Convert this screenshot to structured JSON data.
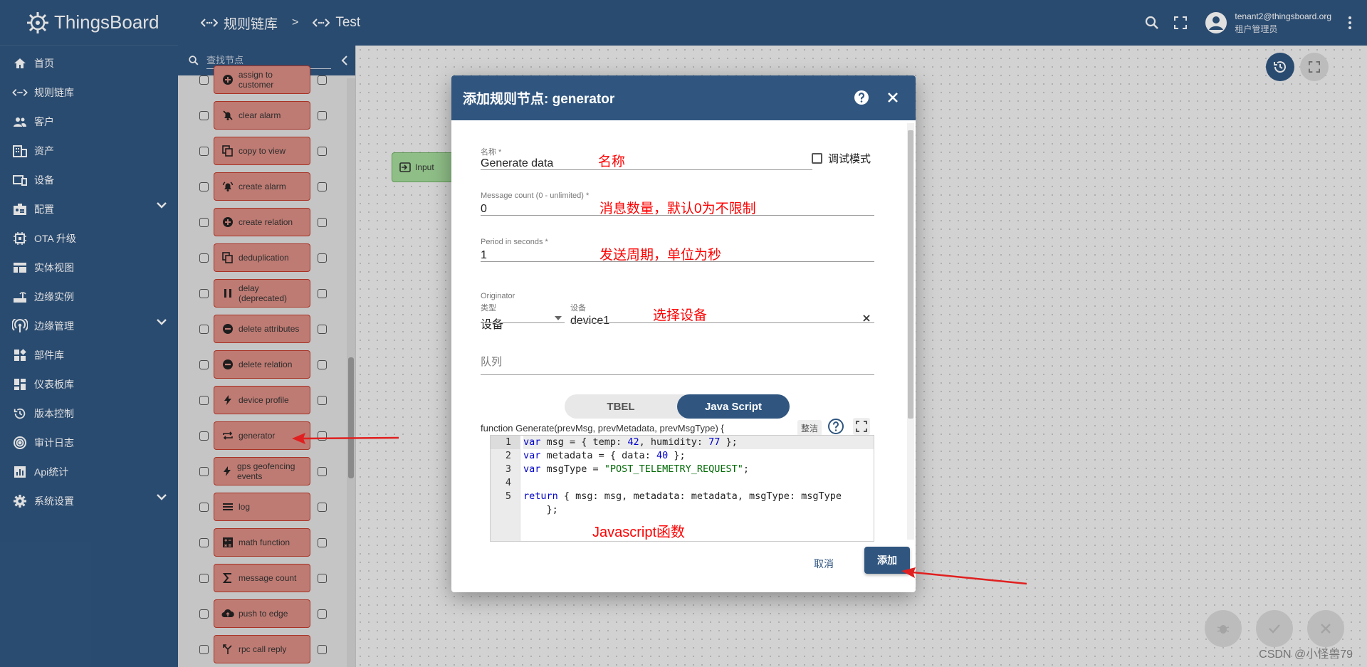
{
  "app": {
    "brand": "ThingsBoard"
  },
  "breadcrumbs": [
    {
      "label": "规则链库"
    },
    {
      "label": "Test"
    }
  ],
  "breadcrumb_separator": ">",
  "user": {
    "email": "tenant2@thingsboard.org",
    "role": "租户管理员"
  },
  "nav": {
    "items": [
      {
        "label": "首页",
        "icon": "home-icon"
      },
      {
        "label": "规则链库",
        "icon": "code-arrows-icon"
      },
      {
        "label": "客户",
        "icon": "people-icon"
      },
      {
        "label": "资产",
        "icon": "building-icon"
      },
      {
        "label": "设备",
        "icon": "devices-icon"
      },
      {
        "label": "配置",
        "icon": "profile-icon",
        "expandable": true
      },
      {
        "label": "OTA 升级",
        "icon": "chip-icon"
      },
      {
        "label": "实体视图",
        "icon": "view-icon"
      },
      {
        "label": "边缘实例",
        "icon": "router-icon"
      },
      {
        "label": "边缘管理",
        "icon": "wifi-icon",
        "expandable": true
      },
      {
        "label": "部件库",
        "icon": "widgets-icon"
      },
      {
        "label": "仪表板库",
        "icon": "dashboard-icon"
      },
      {
        "label": "版本控制",
        "icon": "history-icon"
      },
      {
        "label": "审计日志",
        "icon": "track-icon"
      },
      {
        "label": "Api统计",
        "icon": "chart-icon"
      },
      {
        "label": "系统设置",
        "icon": "settings-icon",
        "expandable": true
      }
    ]
  },
  "library": {
    "search_placeholder": "查找节点",
    "nodes": [
      {
        "label": "assign to customer",
        "icon": "plus-circle-icon"
      },
      {
        "label": "clear alarm",
        "icon": "bell-off-icon"
      },
      {
        "label": "copy to view",
        "icon": "copy-icon"
      },
      {
        "label": "create alarm",
        "icon": "bell-ring-icon"
      },
      {
        "label": "create relation",
        "icon": "plus-circle-icon"
      },
      {
        "label": "deduplication",
        "icon": "copy-icon"
      },
      {
        "label": "delay (deprecated)",
        "icon": "pause-icon"
      },
      {
        "label": "delete attributes",
        "icon": "minus-circle-icon"
      },
      {
        "label": "delete relation",
        "icon": "minus-circle-icon"
      },
      {
        "label": "device profile",
        "icon": "bolt-icon"
      },
      {
        "label": "generator",
        "icon": "repeat-icon"
      },
      {
        "label": "gps geofencing events",
        "icon": "bolt-icon"
      },
      {
        "label": "log",
        "icon": "menu-icon"
      },
      {
        "label": "math function",
        "icon": "calculator-icon"
      },
      {
        "label": "message count",
        "icon": "sigma-icon"
      },
      {
        "label": "push to edge",
        "icon": "cloud-upload-icon"
      },
      {
        "label": "rpc call reply",
        "icon": "call-split-icon"
      }
    ]
  },
  "canvas": {
    "input_node_label": "Input"
  },
  "dialog": {
    "title": "添加规则节点: generator",
    "name_label": "名称 *",
    "name_value": "Generate data",
    "debug_label": "调试模式",
    "count_label": "Message count (0 - unlimited) *",
    "count_value": "0",
    "period_label": "Period in seconds *",
    "period_value": "1",
    "originator_label": "Originator",
    "type_label": "类型",
    "type_value": "设备",
    "device_label": "设备",
    "device_value": "device1",
    "queue_placeholder": "队列",
    "lang_options": [
      "TBEL",
      "Java Script"
    ],
    "lang_selected": "Java Script",
    "function_signature": "function Generate(prevMsg, prevMetadata, prevMsgType) {",
    "tidy_label": "整洁",
    "code_line_numbers": [
      "1",
      "2",
      "3",
      "4",
      "5"
    ],
    "cancel_label": "取消",
    "add_label": "添加"
  },
  "annotations": {
    "name": "名称",
    "count": "消息数量，默认0为不限制",
    "period": "发送周期，单位为秒",
    "device": "选择设备",
    "js": "Javascript函数"
  },
  "watermark": "CSDN @小怪兽79",
  "colors": {
    "primary": "#305680",
    "node_red": "#d98c83",
    "input_green": "#a3d99a",
    "annotation": "#ff0000"
  }
}
